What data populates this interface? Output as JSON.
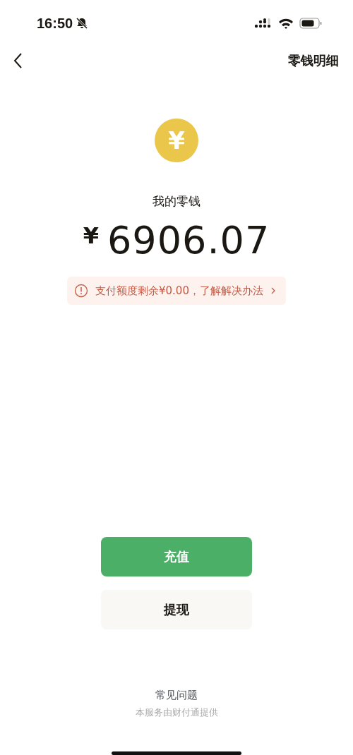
{
  "status_bar": {
    "time": "16:50",
    "silent": true
  },
  "nav": {
    "title": "零钱明细"
  },
  "coin": {
    "symbol": "¥"
  },
  "balance": {
    "label": "我的零钱",
    "currency": "¥",
    "amount": "6906.07"
  },
  "notice": {
    "text": "支付额度剩余¥0.00，了解解决办法"
  },
  "buttons": [
    {
      "label": "充值",
      "kind": "primary"
    },
    {
      "label": "提现",
      "kind": "secondary"
    }
  ],
  "footer": {
    "link": "常见问题",
    "provider": "本服务由财付通提供"
  }
}
